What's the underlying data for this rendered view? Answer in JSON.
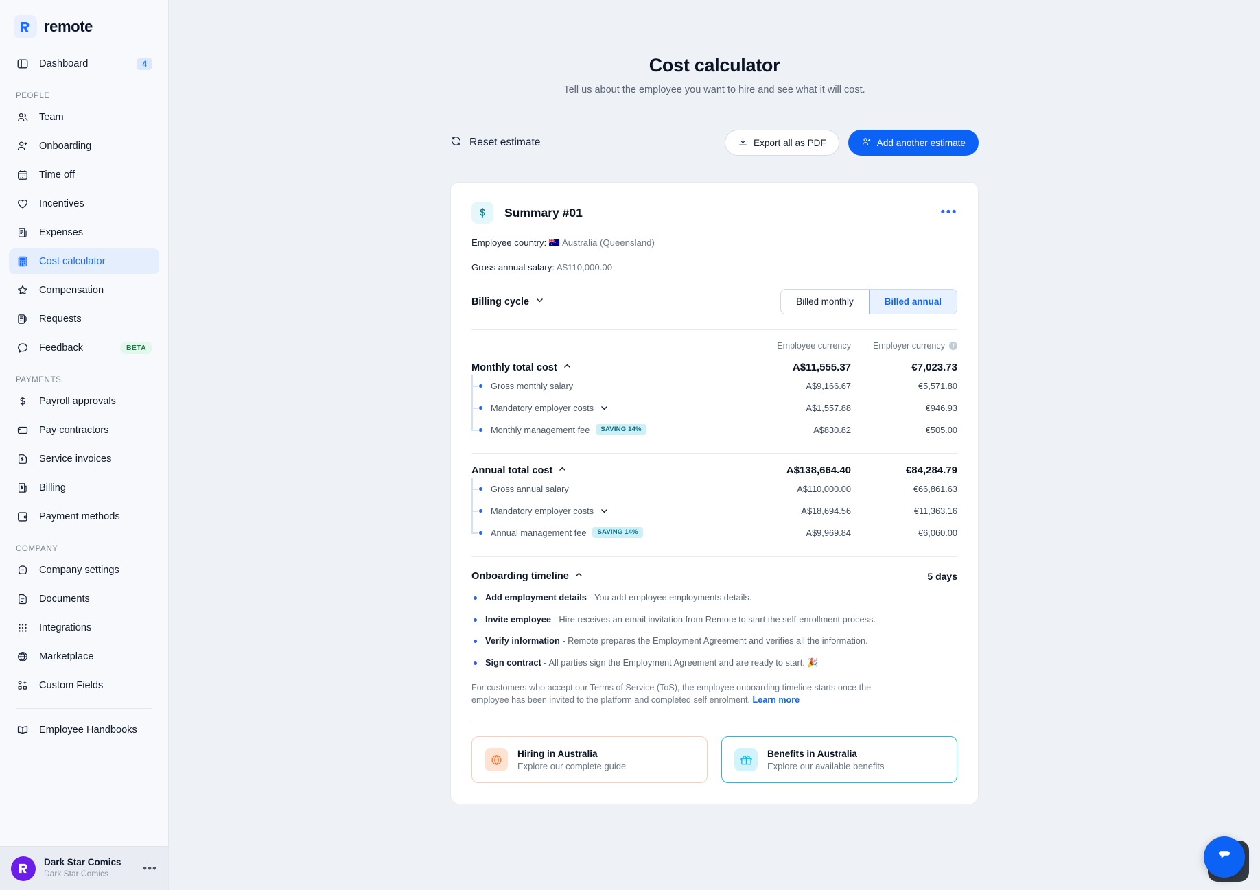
{
  "brand": {
    "name": "remote",
    "mark": "R"
  },
  "sidebar": {
    "dashboard": {
      "label": "Dashboard",
      "badge": "4",
      "icon": "dashboard-icon"
    },
    "sections": [
      {
        "label": "PEOPLE",
        "items": [
          {
            "label": "Team",
            "icon": "team-icon"
          },
          {
            "label": "Onboarding",
            "icon": "user-plus-icon"
          },
          {
            "label": "Time off",
            "icon": "calendar-icon"
          },
          {
            "label": "Incentives",
            "icon": "heart-icon"
          },
          {
            "label": "Expenses",
            "icon": "receipt-icon"
          },
          {
            "label": "Cost calculator",
            "icon": "calculator-icon",
            "active": true
          },
          {
            "label": "Compensation",
            "icon": "star-icon"
          },
          {
            "label": "Requests",
            "icon": "request-icon"
          },
          {
            "label": "Feedback",
            "icon": "chat-icon",
            "badge": "BETA"
          }
        ]
      },
      {
        "label": "PAYMENTS",
        "items": [
          {
            "label": "Payroll approvals",
            "icon": "dollar-icon"
          },
          {
            "label": "Pay contractors",
            "icon": "card-icon"
          },
          {
            "label": "Service invoices",
            "icon": "invoice-icon"
          },
          {
            "label": "Billing",
            "icon": "billing-icon"
          },
          {
            "label": "Payment methods",
            "icon": "wallet-icon"
          }
        ]
      },
      {
        "label": "COMPANY",
        "items": [
          {
            "label": "Company settings",
            "icon": "settings-icon"
          },
          {
            "label": "Documents",
            "icon": "document-icon"
          },
          {
            "label": "Integrations",
            "icon": "integrations-icon"
          },
          {
            "label": "Marketplace",
            "icon": "globe-icon"
          },
          {
            "label": "Custom Fields",
            "icon": "custom-fields-icon"
          }
        ]
      }
    ],
    "footer_items": [
      {
        "label": "Employee Handbooks",
        "icon": "book-icon"
      }
    ],
    "org": {
      "name": "Dark Star Comics",
      "sub": "Dark Star Comics",
      "avatar_letter": "R",
      "menu": "•••"
    }
  },
  "header": {
    "title": "Cost calculator",
    "subtitle": "Tell us about the employee you want to hire and see what it will cost."
  },
  "toolbar": {
    "reset_label": "Reset estimate",
    "export_label": "Export all as PDF",
    "add_label": "Add another estimate"
  },
  "summary": {
    "title": "Summary #01",
    "menu": "•••",
    "country_label": "Employee country:",
    "country_flag": "🇦🇺",
    "country_value": "Australia (Queensland)",
    "salary_label": "Gross annual salary:",
    "salary_value": "A$110,000.00",
    "billing_cycle_label": "Billing cycle",
    "billing_options": [
      "Billed monthly",
      "Billed annual"
    ],
    "billing_selected": "Billed annual",
    "col_employee": "Employee currency",
    "col_employer": "Employer currency",
    "monthly": {
      "label": "Monthly total cost",
      "employee": "A$11,555.37",
      "employer": "€7,023.73",
      "rows": [
        {
          "label": "Gross monthly salary",
          "employee": "A$9,166.67",
          "employer": "€5,571.80",
          "chevron": false,
          "chip": ""
        },
        {
          "label": "Mandatory employer costs",
          "employee": "A$1,557.88",
          "employer": "€946.93",
          "chevron": true,
          "chip": ""
        },
        {
          "label": "Monthly management fee",
          "employee": "A$830.82",
          "employer": "€505.00",
          "chevron": false,
          "chip": "SAVING 14%"
        }
      ]
    },
    "annual": {
      "label": "Annual total cost",
      "employee": "A$138,664.40",
      "employer": "€84,284.79",
      "rows": [
        {
          "label": "Gross annual salary",
          "employee": "A$110,000.00",
          "employer": "€66,861.63",
          "chevron": false,
          "chip": ""
        },
        {
          "label": "Mandatory employer costs",
          "employee": "A$18,694.56",
          "employer": "€11,363.16",
          "chevron": true,
          "chip": ""
        },
        {
          "label": "Annual management fee",
          "employee": "A$9,969.84",
          "employer": "€6,060.00",
          "chevron": false,
          "chip": "SAVING 14%"
        }
      ]
    },
    "timeline": {
      "label": "Onboarding timeline",
      "duration": "5 days",
      "steps": [
        {
          "title": "Add employment details",
          "desc": " - You add employee employments details."
        },
        {
          "title": "Invite employee",
          "desc": " - Hire receives an email invitation from Remote to start the self-enrollment process."
        },
        {
          "title": "Verify information",
          "desc": " - Remote prepares the Employment Agreement and verifies all the information."
        },
        {
          "title": "Sign contract",
          "desc": " - All parties sign the Employment Agreement and are ready to start. 🎉"
        }
      ],
      "note": "For customers who accept our Terms of Service (ToS), the employee onboarding timeline starts once the employee has been invited to the platform and completed self enrolment.",
      "note_link": "Learn more"
    },
    "promos": [
      {
        "title": "Hiring in Australia",
        "sub": "Explore our complete guide",
        "icon": "globe-icon",
        "accent": "#f08a4b"
      },
      {
        "title": "Benefits in Australia",
        "sub": "Explore our available benefits",
        "icon": "gift-icon",
        "accent": "#16c1e0"
      }
    ]
  },
  "chat": {
    "icon": "chat-bubble-icon"
  }
}
